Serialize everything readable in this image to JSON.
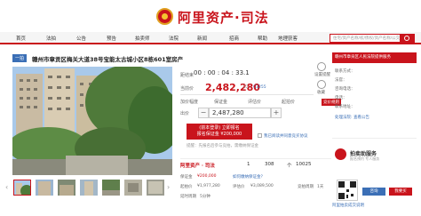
{
  "brand": {
    "name": "阿里资产·司法"
  },
  "nav": {
    "items": [
      "首页",
      "法拍",
      "公告",
      "预告",
      "拍卖师",
      "法院",
      "新闻",
      "招商",
      "帮助",
      "地理获客"
    ],
    "search_placeholder": "住宅/资产名称/权/债权/资产名称/公交线"
  },
  "item": {
    "tag": "一拍",
    "title": "赣州市章贡区梅关大道38号宝能太古城小区8栋601室房产"
  },
  "auction": {
    "countdown_label": "距结束",
    "countdown_prefix": "00",
    "countdown_h": "00",
    "countdown_m": "04",
    "countdown_s": "33.1",
    "countdown_text": "00 : 00 : 04 : 33.1",
    "current_label": "当前价",
    "current_price": "2,482,280",
    "price_unit": "元",
    "bid_count": "12",
    "bidder_label": "出价人",
    "bidder": "C3255",
    "step_labels": [
      "加价幅度",
      "保证金",
      "评估价",
      "起拍价"
    ],
    "bid_label": "出价",
    "bid_value": "2,487,280",
    "minus": "−",
    "plus": "+",
    "register_line1": "(前本登录) 立即报名",
    "register_line2": "报名保证金 ¥200,000",
    "agree_text": "我已阅读并同意竞买协议",
    "notice": "提醒：先报名后参与竞拍，需缴纳保证金",
    "rule_badge": "竞价规则"
  },
  "side_actions": [
    {
      "label": "设置提醒",
      "icon": "bell-icon"
    },
    {
      "label": "收藏",
      "icon": "star-icon"
    },
    {
      "label": "分享",
      "icon": "share-icon"
    }
  ],
  "promo": {
    "logo": "阿里资产 · 司法",
    "num1": "1",
    "num2": "308",
    "num3": "10025",
    "num3_prefix": "个",
    "more": "更多"
  },
  "info": {
    "deposit_label": "保证金",
    "deposit": "¥200,000",
    "deposit_link": "如何缴纳保证金？",
    "start_label": "起拍价",
    "start": "¥1,977,280",
    "eval_label": "评估价",
    "eval": "¥3,089,500",
    "period_label": "竞拍周期",
    "period": "1天",
    "delay_label": "延时周期",
    "delay": "5分钟"
  },
  "sidebar": {
    "court_head": "赣州市章贡区人民法院提供服务",
    "court_lines": [
      "联系方式：",
      "法官：",
      "咨询电话：",
      "电话：",
      "联系地址："
    ],
    "court_links": [
      "处理法院: 查看公告"
    ],
    "svc_title": "拍卖助服务",
    "svc_sub": "报名预约 专人服务",
    "svc_btn1": "咨询",
    "svc_btn2": "我要买",
    "bottom_link": "阿里拍卖成交说明"
  },
  "colors": {
    "brand_red": "#c9141c",
    "link_blue": "#3b6fb6"
  }
}
